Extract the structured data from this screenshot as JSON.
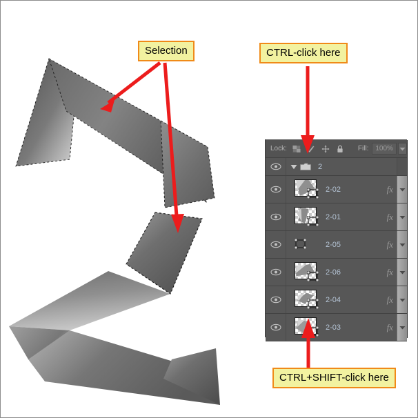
{
  "app": {
    "kind": "photoshop-layers-panel-annotated-screenshot",
    "accent_red": "#e8191b",
    "callout_fill": "#f2f2a0",
    "callout_border": "#f08a18",
    "panel_bg": "#535353",
    "row_bg": "#575757",
    "layer_name_color": "#b4c3d4"
  },
  "callouts": [
    {
      "id": "selection",
      "label": "Selection"
    },
    {
      "id": "ctrl_click",
      "label": "CTRL-click here"
    },
    {
      "id": "ctrl_shift_click",
      "label": "CTRL+SHIFT-click here"
    }
  ],
  "layers_panel": {
    "lock_row": {
      "lock_label": "Lock:",
      "lock_icons": [
        {
          "name": "lock-transparent-pixels-icon"
        },
        {
          "name": "lock-image-pixels-icon"
        },
        {
          "name": "lock-position-icon"
        },
        {
          "name": "lock-all-icon"
        }
      ],
      "fill_label": "Fill:",
      "fill_value": "100%"
    },
    "group": {
      "name": "2",
      "expanded": true
    },
    "layers": [
      {
        "name": "2-02",
        "fx": "fx",
        "thumb": "checker-artwork",
        "has_transform_icon": true,
        "visible": true
      },
      {
        "name": "2-01",
        "fx": "fx",
        "thumb": "checker-artwork",
        "has_transform_icon": true,
        "visible": true
      },
      {
        "name": "2-05",
        "fx": "fx",
        "thumb": "none",
        "has_transform_icon": true,
        "visible": true
      },
      {
        "name": "2-06",
        "fx": "fx",
        "thumb": "checker-artwork",
        "has_transform_icon": true,
        "visible": true
      },
      {
        "name": "2-04",
        "fx": "fx",
        "thumb": "checker-artwork",
        "has_transform_icon": true,
        "visible": true
      },
      {
        "name": "2-03",
        "fx": "fx",
        "thumb": "checker-artwork",
        "has_transform_icon": true,
        "visible": true
      }
    ]
  },
  "artwork": {
    "description": "gray gradient folded-ribbon shapes with dashed marching-ants selection outline"
  }
}
